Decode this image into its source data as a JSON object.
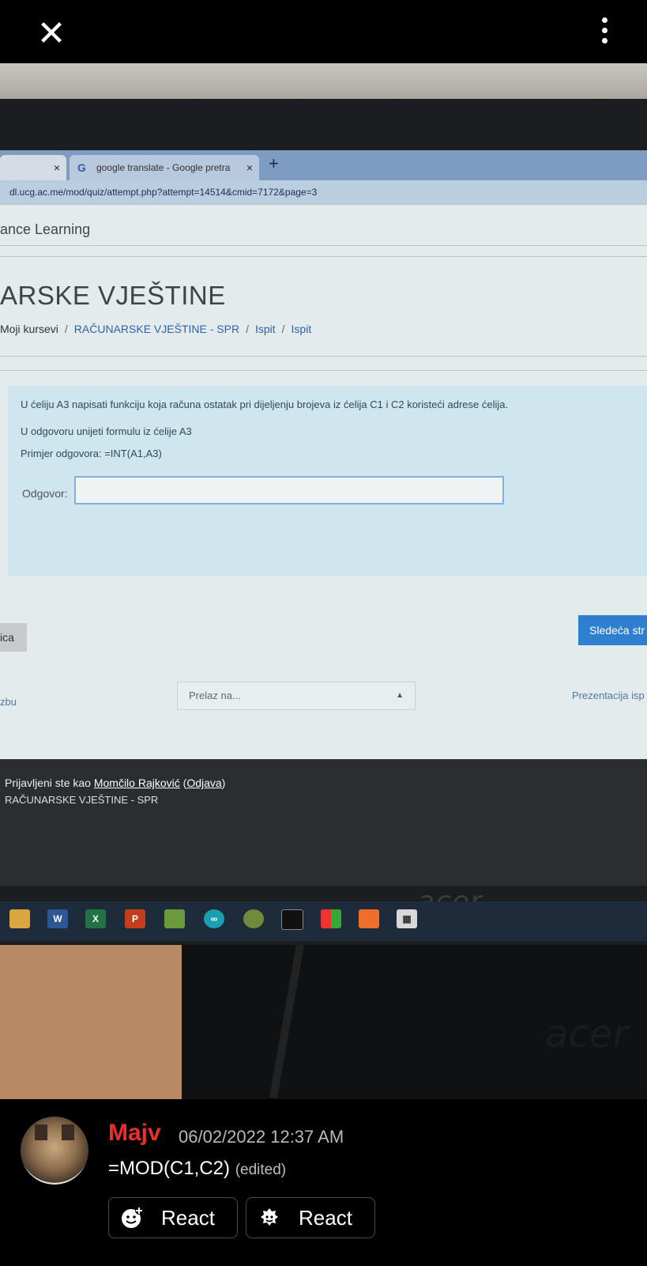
{
  "top_bar": {
    "close_icon": "close-icon",
    "more_icon": "more-vertical-icon"
  },
  "browser": {
    "tab1_close": "×",
    "tab2": {
      "icon": "G",
      "title": "google translate - Google pretra",
      "close": "×"
    },
    "new_tab": "+",
    "url": "dl.ucg.ac.me/mod/quiz/attempt.php?attempt=14514&cmid=7172&page=3"
  },
  "moodle": {
    "site_name": "ance Learning",
    "course_title": "ARSKE VJEŠTINE",
    "breadcrumb": {
      "item1": "Moji kursevi",
      "sep": "/",
      "item2": "RAČUNARSKE VJEŠTINE - SPR",
      "item3": "Ispit",
      "item4": "Ispit"
    },
    "question": {
      "line1": "U ćeliju A3 napisati funkciju koja računa ostatak pri dijeljenju brojeva iz ćelija C1 i C2 koristeći adrese ćelija.",
      "line2": "U odgovoru unijeti formulu iz ćelije A3",
      "line3": "Primjer odgovora:    =INT(A1,A3)",
      "answer_label": "Odgovor:",
      "answer_value": ""
    },
    "prev_button": "ica",
    "next_button": "Sledeća str",
    "nav_left": "zbu",
    "jump_select": "Prelaz na...",
    "nav_right": "Prezentacija isp",
    "footer": {
      "logged_prefix": "Prijavljeni ste kao ",
      "user": "Momčilo Rajković",
      "logout_open": " (",
      "logout": "Odjava",
      "logout_close": ")",
      "course": "RAČUNARSKE VJEŠTINE - SPR"
    }
  },
  "monitor_brand": "acer",
  "taskbar_icons": [
    "file-explorer-icon",
    "word-icon",
    "excel-icon",
    "powerpoint-icon",
    "image-app-icon",
    "arduino-icon",
    "android-studio-icon",
    "terminal-icon",
    "windows-store-icon",
    "xampp-icon",
    "calculator-icon"
  ],
  "message": {
    "username": "Majv",
    "timestamp": "06/02/2022 12:37 AM",
    "text": "=MOD(C1,C2)",
    "edited": "(edited)",
    "react1_label": "React",
    "react2_label": "React"
  },
  "colors": {
    "username": "#e8302a",
    "next_button": "#2f7fd1",
    "link": "#2f61a8"
  }
}
